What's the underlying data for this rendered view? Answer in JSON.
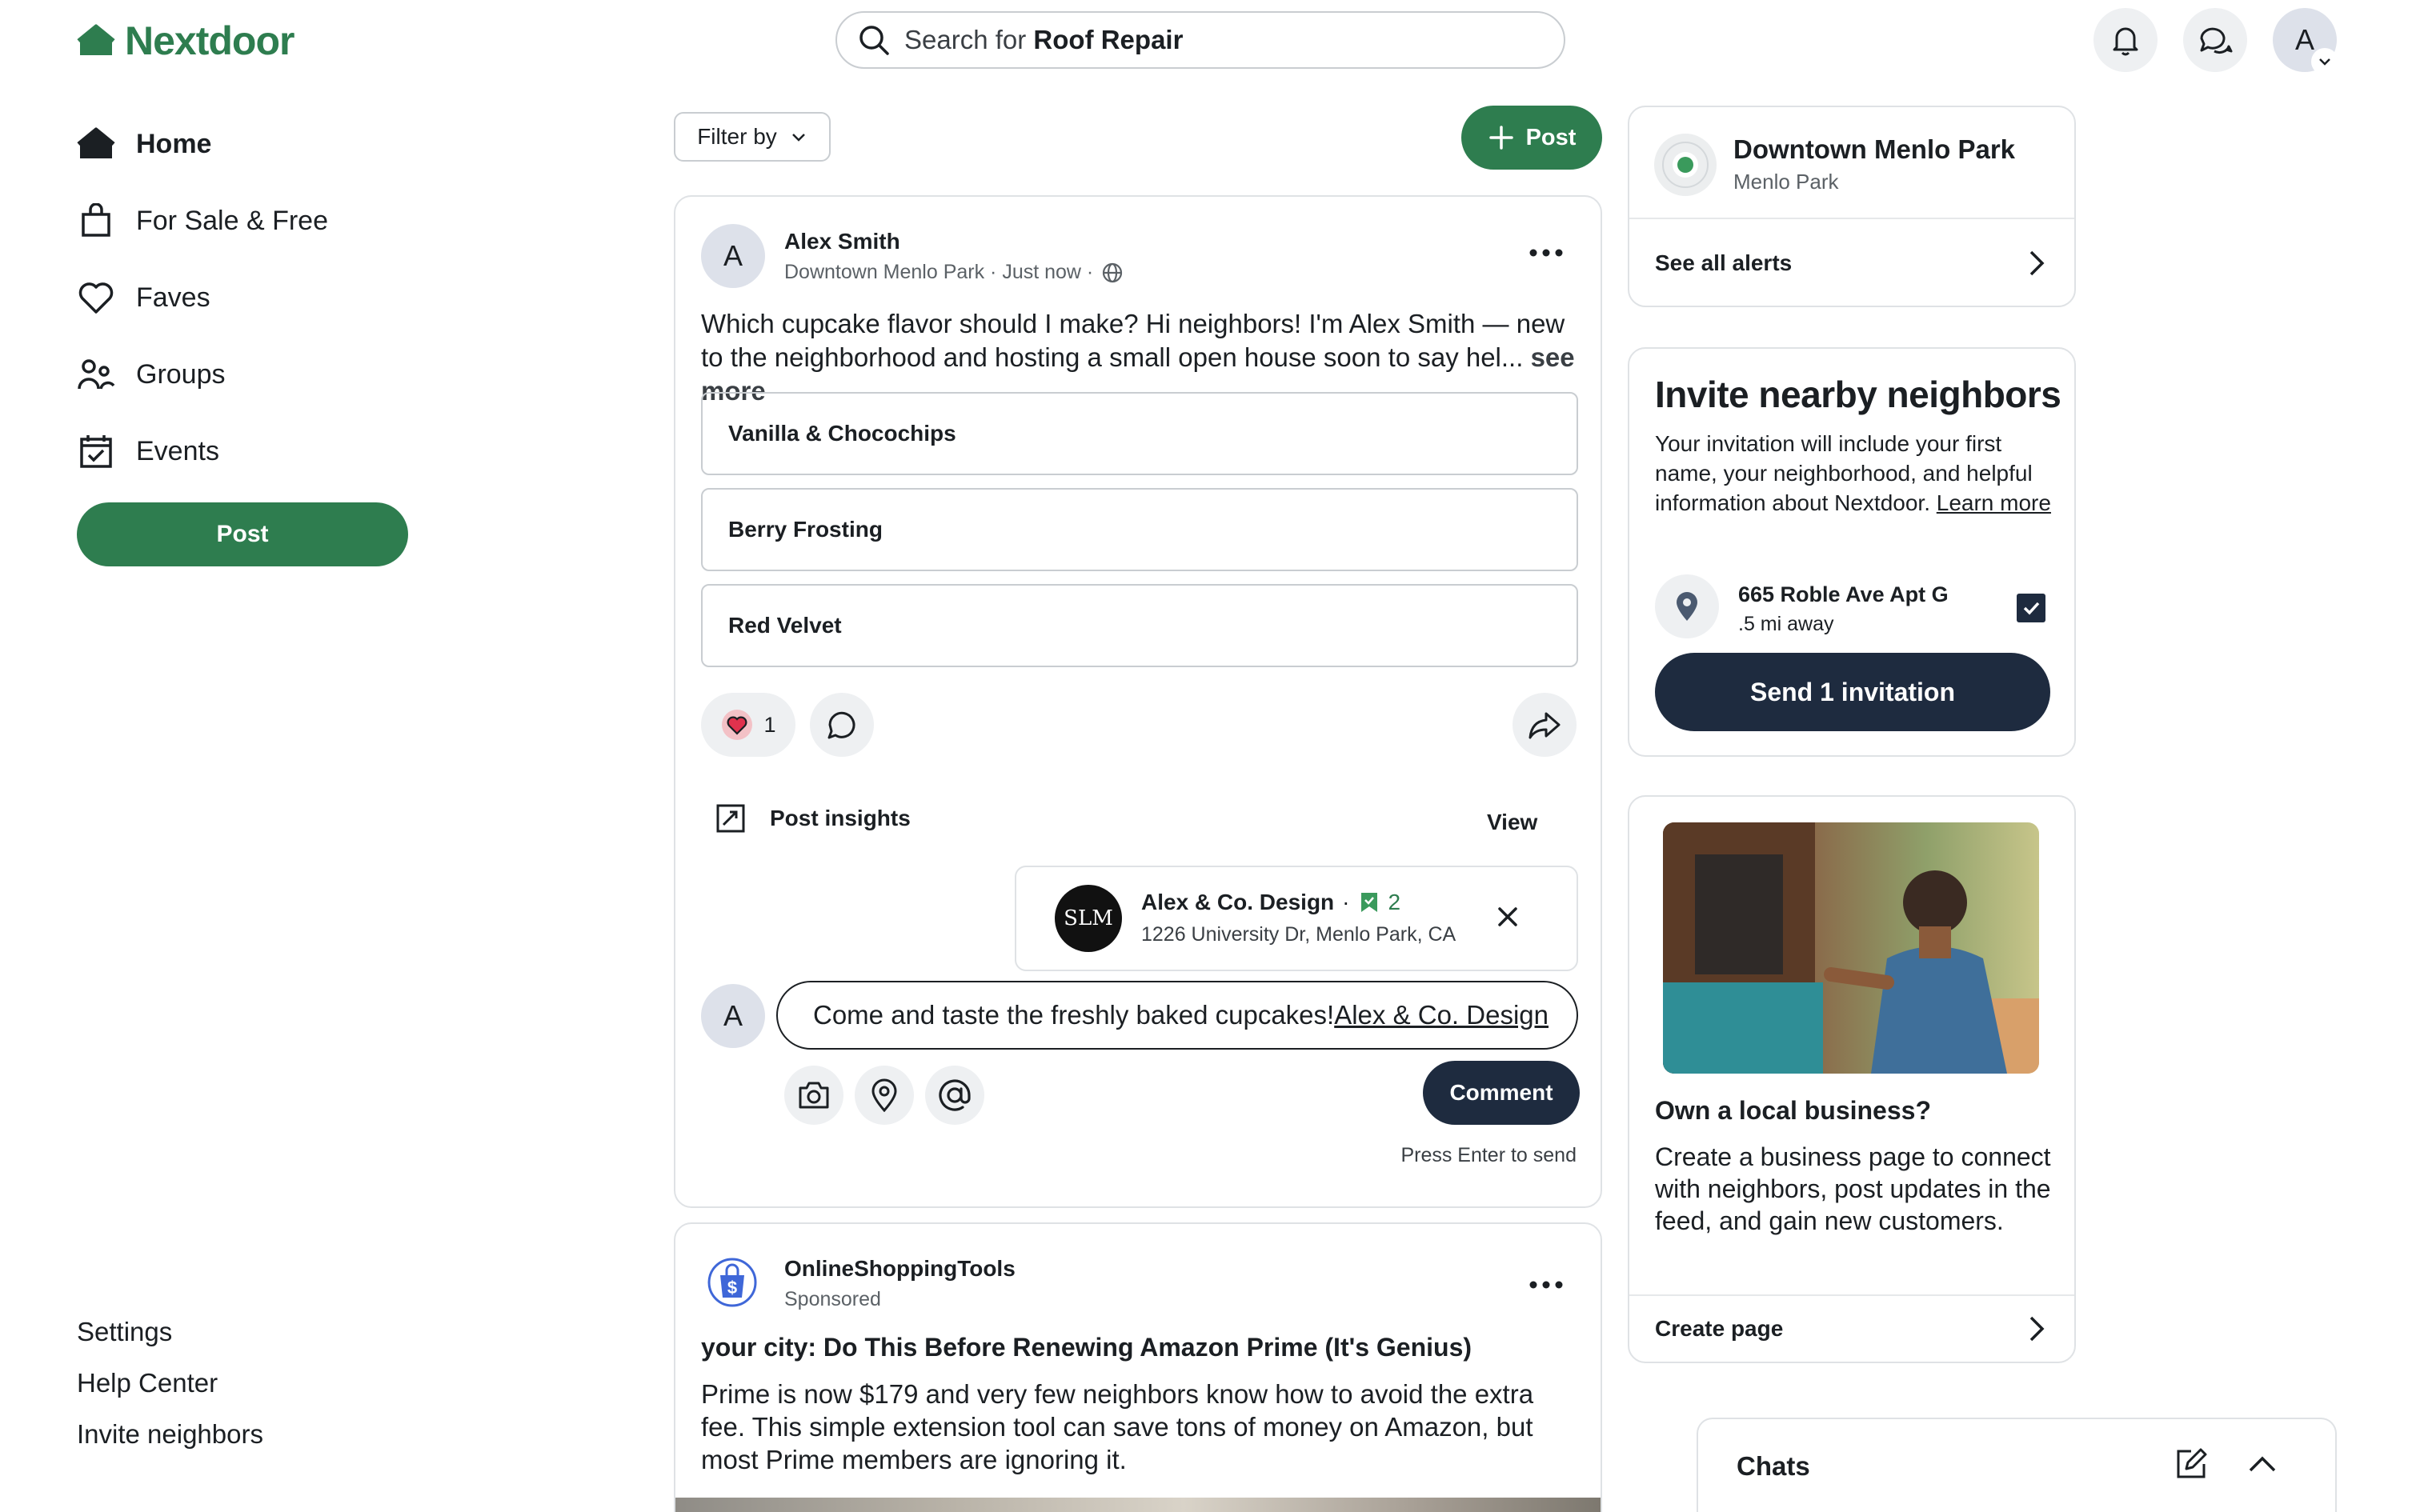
{
  "app": {
    "logo_text": "Nextdoor",
    "brand_color": "#2e7d4f",
    "dark_color": "#1e2b3f"
  },
  "header": {
    "search_prefix": "Search for ",
    "search_term": "Roof Repair",
    "avatar_initial": "A"
  },
  "nav": {
    "items": [
      {
        "label": "Home",
        "icon": "house-icon"
      },
      {
        "label": "For Sale & Free",
        "icon": "shopping-bag-icon"
      },
      {
        "label": "Faves",
        "icon": "heart-icon"
      },
      {
        "label": "Groups",
        "icon": "people-icon"
      },
      {
        "label": "Events",
        "icon": "calendar-icon"
      }
    ],
    "post_label": "Post",
    "footer": [
      "Settings",
      "Help Center",
      "Invite neighbors"
    ]
  },
  "feed": {
    "filter_label": "Filter by",
    "post_label": "Post",
    "post1": {
      "avatar_initial": "A",
      "author": "Alex Smith",
      "meta": "Downtown Menlo Park · Just now ·",
      "body": "Which cupcake flavor should I make? Hi neighbors! I'm Alex Smith — new to the neighborhood and hosting a small open house soon to say hel...",
      "see_more": "see more",
      "poll_options": [
        "Vanilla & Chocochips",
        "Berry Frosting",
        "Red Velvet"
      ],
      "reaction_count": "1",
      "insights_label": "Post insights",
      "insights_view": "View",
      "business_mention": {
        "logo_text": "SLM",
        "name": "Alex & Co. Design",
        "sep": "·",
        "badge_count": "2",
        "address": "1226 University Dr, Menlo Park, CA"
      },
      "comment_avatar_initial": "A",
      "comment_text": "Come and taste the freshly baked cupcakes! ",
      "comment_link": "Alex & Co. Design",
      "comment_button": "Comment",
      "enter_hint": "Press Enter to send"
    },
    "post2": {
      "author": "OnlineShoppingTools",
      "meta": "Sponsored",
      "title": "your city: Do This Before Renewing Amazon Prime (It's Genius)",
      "body": "Prime is now $179 and very few neighbors know how to avoid the extra fee. This simple extension tool can save tons of money on Amazon, but most Prime members are ignoring it."
    }
  },
  "sidebar": {
    "alert": {
      "title": "Downtown Menlo Park",
      "subtitle": "Menlo Park",
      "see_all": "See all alerts"
    },
    "invite": {
      "title": "Invite nearby neighbors",
      "desc": "Your invitation will include your first name, your neighborhood, and helpful information about Nextdoor. ",
      "learn_more": "Learn more",
      "address": "665 Roble Ave Apt G",
      "distance": ".5 mi away",
      "checked": true,
      "send_label": "Send 1 invitation"
    },
    "business": {
      "title": "Own a local business?",
      "desc": "Create a business page to connect with neighbors, post updates in the feed, and gain new customers.",
      "cta": "Create page"
    },
    "chats": {
      "title": "Chats"
    }
  }
}
